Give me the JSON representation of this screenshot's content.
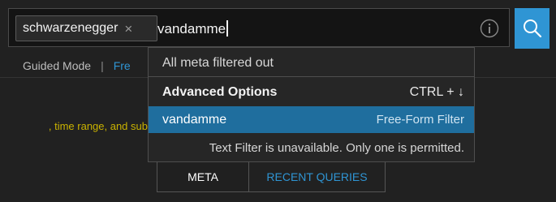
{
  "search": {
    "token_label": "schwarzenegger",
    "token_close_glyph": "×",
    "query": "vandamme"
  },
  "icons": {
    "info": "info-circle-icon",
    "search": "magnifier-icon",
    "close": "close-icon"
  },
  "mode_bar": {
    "guided_label": "Guided Mode",
    "separator": "|",
    "free_label_partial": "Fre"
  },
  "background_hint": ", time range, and sub",
  "dropdown": {
    "meta_status": "All meta filtered out",
    "advanced_label": "Advanced Options",
    "advanced_shortcut": "CTRL + ↓",
    "selected_value": "vandamme",
    "selected_type": "Free-Form Filter",
    "unavailable_message": "Text Filter is unavailable. Only one is permitted."
  },
  "tabs": [
    {
      "label": "META",
      "active": true
    },
    {
      "label": "RECENT QUERIES",
      "active": false
    }
  ],
  "colors": {
    "accent": "#2f95d4",
    "selected_row": "#1f6e9e",
    "background": "#212121",
    "hint_yellow": "#c9b200"
  }
}
